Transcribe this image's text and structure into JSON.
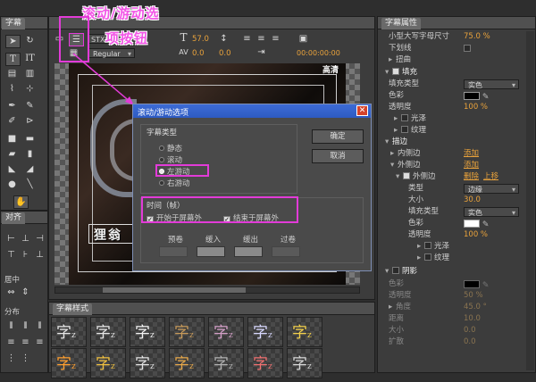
{
  "tools_panel": {
    "title": "字幕"
  },
  "align_panel": {
    "title": "对齐",
    "center_label": "居中",
    "distribute_label": "分布"
  },
  "title_toolbar": {
    "font_name": "STXI",
    "font_style": "Regular",
    "font_size": "57.0",
    "kerning": "0.0",
    "leading": "0.0",
    "timecode": "00:00:00:00"
  },
  "canvas": {
    "clip_label": "高清",
    "caption_text": "狸翁"
  },
  "styles_panel": {
    "title": "字幕样式",
    "glyph": "字",
    "sub": "z"
  },
  "callout": {
    "line1": "滚动/游动选",
    "line2": "项按钮"
  },
  "dialog": {
    "title": "滚动/游动选项",
    "type_group_label": "字幕类型",
    "options": [
      "静态",
      "滚动",
      "左游动",
      "右游动"
    ],
    "selected_option": "左游动",
    "time_group_label": "时间（帧）",
    "start_offscreen": "开始于屏幕外",
    "end_offscreen": "结束于屏幕外",
    "fields": [
      "预卷",
      "缓入",
      "缓出",
      "过卷"
    ],
    "ok": "确定",
    "cancel": "取消"
  },
  "properties": {
    "title": "字幕属性",
    "small_caps_size_label": "小型大写字母尺寸",
    "small_caps_size": "75.0 %",
    "underline": "下划线",
    "distort": "扭曲",
    "fill": "填充",
    "fill_type_label": "填充类型",
    "fill_type": "实色",
    "color_label": "色彩",
    "opacity_label": "透明度",
    "opacity": "100 %",
    "sheen": "光泽",
    "texture": "纹理",
    "stroke": "描边",
    "inner_stroke": "内侧边",
    "add": "添加",
    "outer_stroke": "外侧边",
    "outer_item": "外侧边",
    "delete": "删除",
    "up": "上移",
    "type_label": "类型",
    "type_value": "边缘",
    "size_label": "大小",
    "size_value": "30.0",
    "fill_type_label2": "填充类型",
    "fill_type_value2": "实色",
    "color_label2": "色彩",
    "opacity_label2": "透明度",
    "opacity_value2": "100 %",
    "sheen2": "光泽",
    "texture2": "纹理",
    "shadow": "阴影",
    "shadow_color": "色彩",
    "shadow_opacity": "透明度",
    "shadow_opacity_value": "50 %",
    "angle": "角度",
    "angle_value": "45.0 °",
    "distance": "距离",
    "distance_value": "10.0",
    "shadow_size": "大小",
    "shadow_size_value": "0.0",
    "spread": "扩散",
    "spread_value": "0.0"
  },
  "colors": {
    "accent": "#e9a23b",
    "callout": "#f254e6",
    "dialog_title": "#2e5bc2",
    "close": "#d5432b"
  }
}
